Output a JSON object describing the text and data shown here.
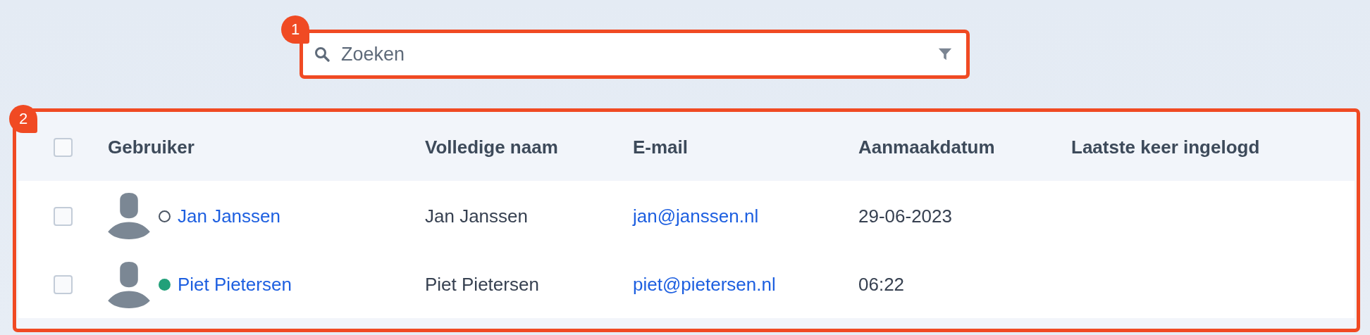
{
  "annotations": [
    "1",
    "2"
  ],
  "search": {
    "placeholder": "Zoeken"
  },
  "table": {
    "select_all": {
      "checked": false
    },
    "columns": [
      "Gebruiker",
      "Volledige naam",
      "E-mail",
      "Aanmaakdatum",
      "Laatste keer ingelogd"
    ],
    "rows": [
      {
        "checked": false,
        "online": false,
        "user": "Jan Janssen",
        "full_name": "Jan Janssen",
        "email": "jan@janssen.nl",
        "created": "29-06-2023"
      },
      {
        "checked": false,
        "online": true,
        "user": "Piet Pietersen",
        "full_name": "Piet Pietersen",
        "email": "piet@pietersen.nl",
        "created": "06:22"
      }
    ]
  }
}
